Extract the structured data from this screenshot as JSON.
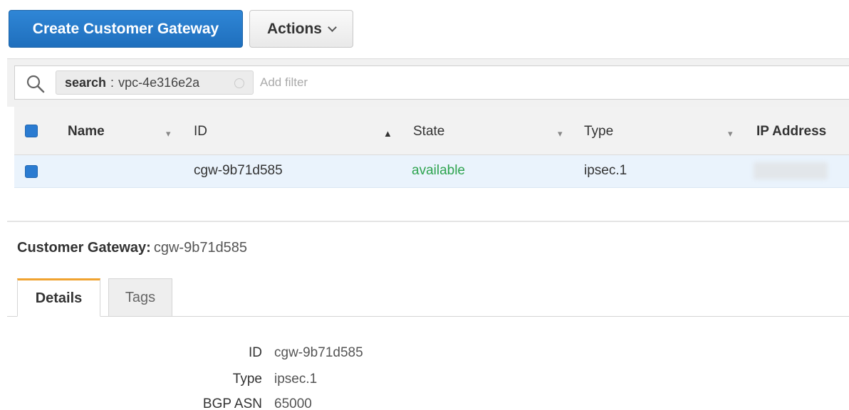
{
  "toolbar": {
    "create_label": "Create Customer Gateway",
    "actions_label": "Actions"
  },
  "filter": {
    "token_key": "search",
    "token_sep": ":",
    "token_value": "vpc-4e316e2a",
    "placeholder": "Add filter"
  },
  "table": {
    "headers": {
      "name": "Name",
      "id": "ID",
      "state": "State",
      "type": "Type",
      "ip": "IP Address"
    },
    "rows": [
      {
        "name": "",
        "id": "cgw-9b71d585",
        "state": "available",
        "type": "ipsec.1",
        "ip": ""
      }
    ]
  },
  "detail": {
    "title_label": "Customer Gateway:",
    "title_value": "cgw-9b71d585",
    "tabs": [
      {
        "label": "Details"
      },
      {
        "label": "Tags"
      }
    ],
    "fields": [
      {
        "label": "ID",
        "value": "cgw-9b71d585"
      },
      {
        "label": "Type",
        "value": "ipsec.1"
      },
      {
        "label": "BGP ASN",
        "value": "65000"
      }
    ]
  },
  "colors": {
    "primary": "#1f6fbd",
    "state_available": "#2ea44f",
    "active_tab_accent": "#f0a330",
    "row_selected": "#eaf3fc"
  }
}
